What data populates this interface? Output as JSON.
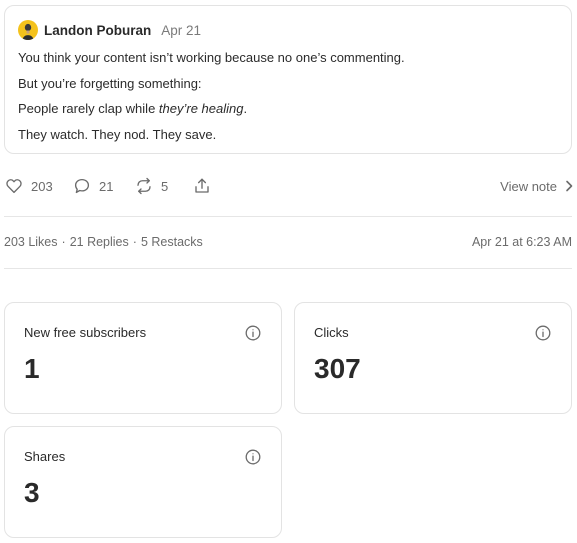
{
  "note": {
    "author": "Landon Poburan",
    "date": "Apr 21",
    "lines": [
      "You think your content isn’t working because no one’s commenting.",
      "But you’re forgetting something:"
    ],
    "line3_prefix": "People rarely clap while ",
    "line3_emphasis": "they’re healing",
    "line3_suffix": ".",
    "line4": "They watch. They nod. They save."
  },
  "actions": {
    "likes": "203",
    "replies": "21",
    "restacks": "5",
    "view_note": "View note",
    "icons": [
      "heart-icon",
      "comment-icon",
      "restack-icon",
      "share-icon",
      "chevron-right-icon"
    ]
  },
  "stats": {
    "likes": "203 Likes",
    "replies": "21 Replies",
    "restacks": "5 Restacks",
    "separator": "·",
    "timestamp": "Apr 21 at 6:23 AM"
  },
  "metrics": [
    {
      "label": "New free subscribers",
      "value": "1"
    },
    {
      "label": "Clicks",
      "value": "307"
    },
    {
      "label": "Shares",
      "value": "3"
    }
  ],
  "colors": {
    "avatar_bg": "#f4c21c",
    "muted_text": "#6b6b6b",
    "border": "#e3e3e3"
  }
}
